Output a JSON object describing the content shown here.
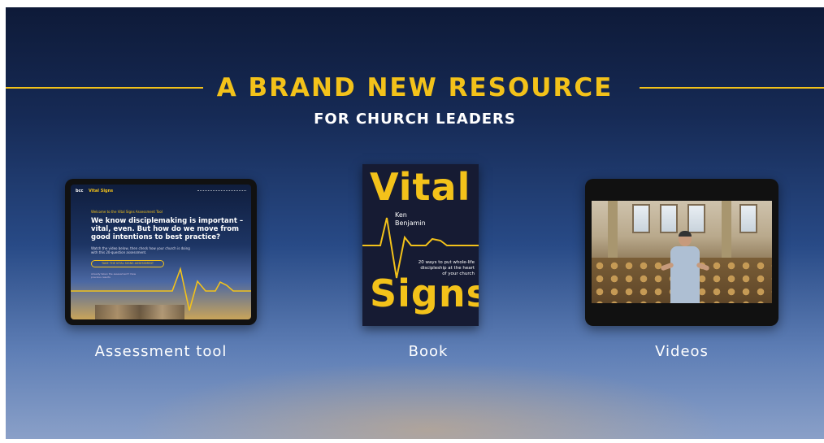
{
  "header": {
    "title": "A BRAND NEW RESOURCE",
    "subtitle": "FOR CHURCH LEADERS"
  },
  "colors": {
    "accent": "#f3c21a",
    "background_top": "#0e1a38",
    "background_bottom": "#8aa0c8"
  },
  "items": [
    {
      "caption": "Assessment tool",
      "screen": {
        "logo": "bcc",
        "brand": "Vital Signs",
        "welcome": "Welcome to the Vital Signs Assessment Tool",
        "headline": "We know disciplemaking is important – vital, even. But how do we move from good intentions to best practice?",
        "body": "Watch the video below, then check how your church is doing with this 20-question assessment.",
        "button": "TAKE THE VITAL SIGNS ASSESSMENT",
        "footnote": "Already taken the assessment? View previous results"
      }
    },
    {
      "caption": "Book",
      "cover": {
        "title_top": "Vital",
        "title_bottom": "Signs",
        "author_first": "Ken",
        "author_last": "Benjamin",
        "tagline": "20 ways to put whole-life discipleship at the heart of your church"
      }
    },
    {
      "caption": "Videos"
    }
  ]
}
